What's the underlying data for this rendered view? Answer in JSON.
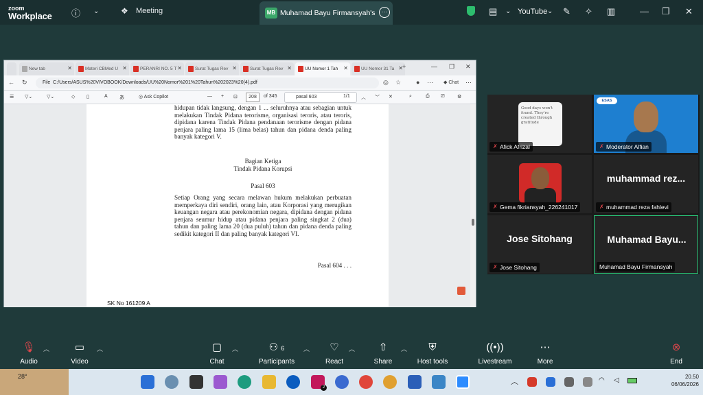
{
  "app": {
    "logo_line1": "zoom",
    "logo_line2": "Workplace",
    "meeting_label": "Meeting"
  },
  "share_tab": {
    "initials": "MB",
    "title": "Muhamad Bayu Firmansyah's scre"
  },
  "top_right": {
    "youtube_label": "YouTube"
  },
  "browser": {
    "tabs": [
      "New tab",
      "Materi CBMed U",
      "PERANRI NO. 5 T",
      "Surat Tugas Rev",
      "Surat Tugas Rev",
      "UU Nomor 1 Tah",
      "UU Nomor 31 Ta"
    ],
    "active_tab": 5,
    "address": "C:/Users/ASUS%20VIVOBOOK/Downloads/UU%20Nomor%201%20Tahun%202023%20(4).pdf",
    "file_label": "File",
    "chat_label": "Chat",
    "ask_copilot": "Ask Copilot",
    "page_current": "208",
    "page_total": "of 345",
    "find_text": "pasal 603",
    "find_count": "1/1"
  },
  "doc": {
    "para1": "hidupan tidak langsung, dengan 1 ... seluruhnya atau sebagian untuk melakukan Tindak Pidana terorisme, organisasi teroris, atau teroris, dipidana karena Tindak Pidana pendanaan terorisme dengan pidana penjara paling lama 15 (lima belas) tahun dan pidana denda paling banyak kategori V.",
    "section": "Bagian Ketiga",
    "section_title": "Tindak Pidana Korupsi",
    "pasal": "Pasal 603",
    "para2": "Setiap Orang yang secara melawan hukum melakukan perbuatan memperkaya diri sendiri, orang lain, atau Korporasi yang merugikan keuangan negara atau perekonomian negara, dipidana dengan pidana penjara seumur hidup atau pidana penjara paling singkat 2 (dua) tahun dan paling lama 20 (dua puluh) tahun dan pidana denda paling sedikit kategori II dan paling banyak kategori VI.",
    "next": "Pasal 604 . . .",
    "footer": "SK No 161209 A"
  },
  "participants_gallery": [
    {
      "name": "Afick Afrizal",
      "muted": true
    },
    {
      "name": "Moderator Alfian",
      "muted": true
    },
    {
      "name": "Gema fikriansyah_226241017",
      "muted": true
    },
    {
      "name": "muhammad reza fahlevi",
      "muted": true,
      "display": "muhammad  rez..."
    },
    {
      "name": "Jose Sitohang",
      "muted": true,
      "display": "Jose Sitohang"
    },
    {
      "name": "Muhamad Bayu Firmansyah",
      "muted": false,
      "display": "Muhamad  Bayu..."
    }
  ],
  "card_text": "Good days won't found. They're created through gratitude",
  "esas_badge": "ESAS",
  "controls": [
    {
      "label": "Audio",
      "icon": "mic-muted-icon"
    },
    {
      "label": "Video",
      "icon": "video-icon"
    },
    {
      "label": "Chat",
      "icon": "chat-icon"
    },
    {
      "label": "Participants",
      "icon": "participants-icon",
      "count": "6"
    },
    {
      "label": "React",
      "icon": "heart-icon"
    },
    {
      "label": "Share",
      "icon": "share-icon"
    },
    {
      "label": "Host tools",
      "icon": "shield-icon"
    },
    {
      "label": "Livestream",
      "icon": "livestream-icon"
    },
    {
      "label": "More",
      "icon": "more-icon"
    },
    {
      "label": "End",
      "icon": "end-icon"
    }
  ],
  "taskbar": {
    "temp": "28°",
    "badge": "2",
    "time": "20.50",
    "date": "06/06/2026"
  },
  "colors": {
    "zoom_bg": "#1f3a3a",
    "accent_green": "#2ad17e",
    "mute_red": "#e0464b"
  }
}
